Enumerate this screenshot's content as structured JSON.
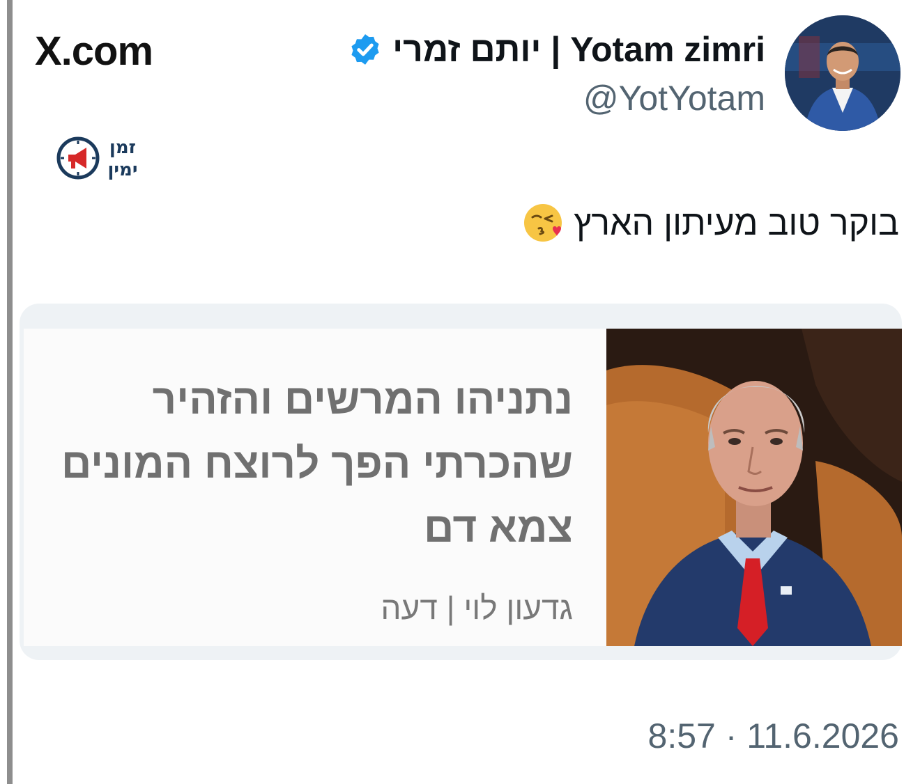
{
  "brand": {
    "site": "X.com"
  },
  "author": {
    "display_name": "יותם זמרי | Yotam zimri",
    "handle": "@YotYotam",
    "verified": true,
    "verified_icon": "verified-badge-icon",
    "avatar_icon": "profile-photo"
  },
  "source_logo": {
    "line1": "זמן",
    "line2": "ימין"
  },
  "tweet": {
    "text": "בוקר טוב מעיתון הארץ",
    "emoji": "face-blowing-a-kiss-icon"
  },
  "card": {
    "headline": "נתניהו המרשים והזהיר שהכרתי הפך לרוצח המונים צמא דם",
    "byline": "גדעון לוי | דעה",
    "image_icon": "article-photo"
  },
  "timestamp": "8:57 · 11.6.2026",
  "colors": {
    "verified_blue": "#1d9bf0",
    "muted_text": "#536471",
    "card_background": "#eef2f5",
    "logo_red": "#d62828",
    "logo_navy": "#1b3a5c"
  }
}
